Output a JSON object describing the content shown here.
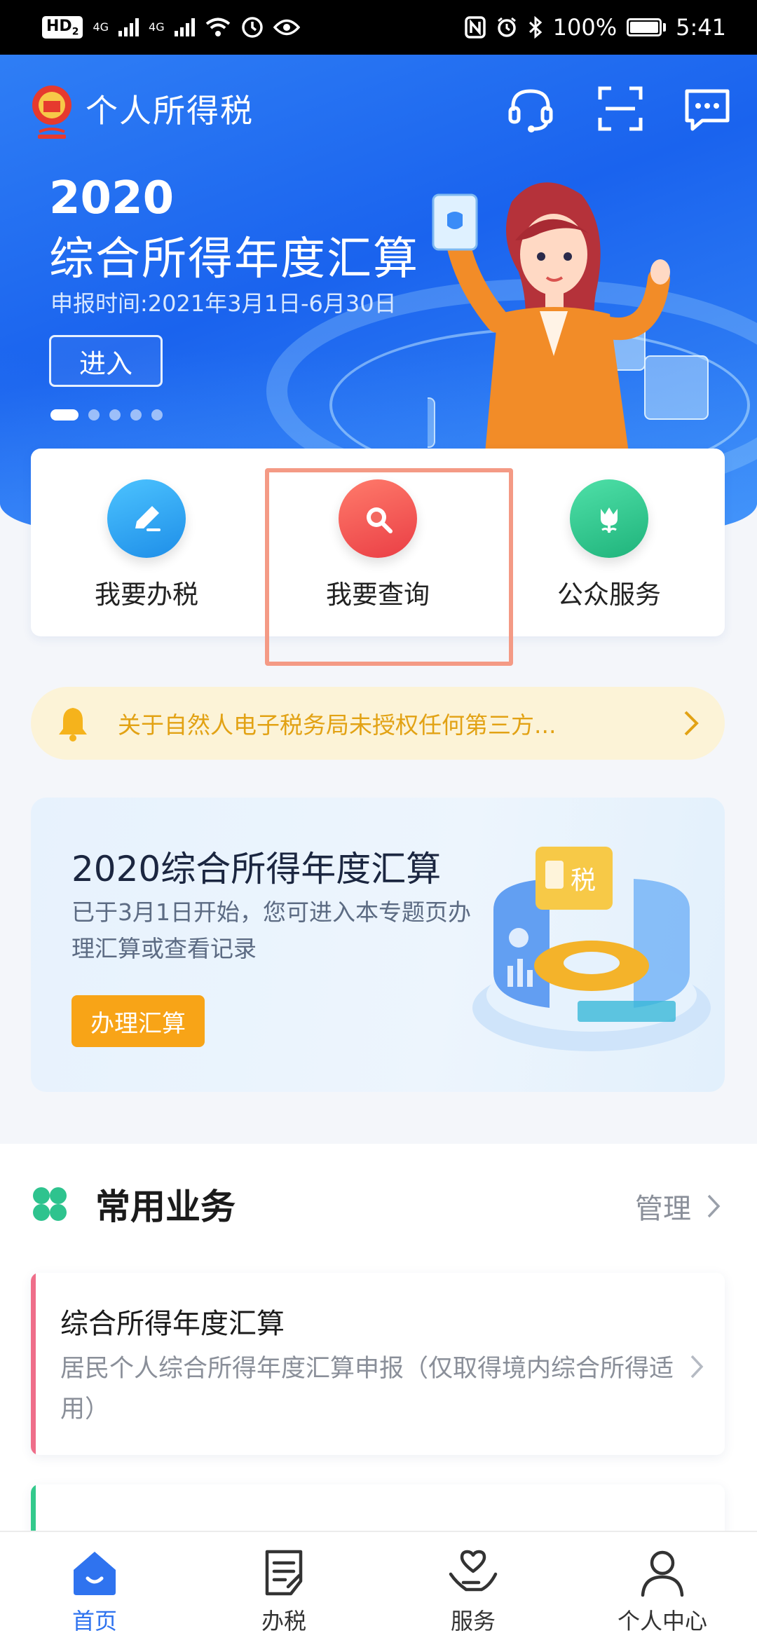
{
  "status_bar": {
    "hd": "HD",
    "hd_sub": "2",
    "network_1": "4G",
    "network_2": "4G",
    "battery": "100%",
    "time": "5:41"
  },
  "header": {
    "app_title": "个人所得税",
    "icons": [
      "headset-icon",
      "scan-icon",
      "message-icon"
    ]
  },
  "banner": {
    "year": "2020",
    "title": "综合所得年度汇算",
    "date": "申报时间:2021年3月1日-6月30日",
    "enter_label": "进入",
    "slide_count": 5,
    "active_slide": 1
  },
  "quick_actions": [
    {
      "label": "我要办税",
      "icon": "pen-icon",
      "color": "#2fa8f0"
    },
    {
      "label": "我要查询",
      "icon": "search-icon",
      "color": "#f45a5a"
    },
    {
      "label": "公众服务",
      "icon": "tulip-icon",
      "color": "#2ec38e"
    }
  ],
  "notice": {
    "text": "关于自然人电子税务局未授权任何第三方...",
    "icon": "bell-icon"
  },
  "promo": {
    "title": "2020综合所得年度汇算",
    "description": "已于3月1日开始，您可进入本专题页办理汇算或查看记录",
    "button_label": "办理汇算",
    "art_label": "税"
  },
  "common_services": {
    "title": "常用业务",
    "manage_label": "管理",
    "items": [
      {
        "title": "综合所得年度汇算",
        "description": "居民个人综合所得年度汇算申报（仅取得境内综合所得适用）"
      }
    ]
  },
  "tabbar": {
    "tabs": [
      {
        "label": "首页",
        "icon": "home-icon",
        "active": true
      },
      {
        "label": "办税",
        "icon": "document-icon",
        "active": false
      },
      {
        "label": "服务",
        "icon": "heart-hand-icon",
        "active": false
      },
      {
        "label": "个人中心",
        "icon": "person-icon",
        "active": false
      }
    ]
  },
  "colors": {
    "primary": "#2f73ef",
    "banner_blue": "#1a63ee",
    "notice_text": "#e2a214",
    "promo_button": "#f8a417",
    "highlight_border": "#f49a85"
  }
}
